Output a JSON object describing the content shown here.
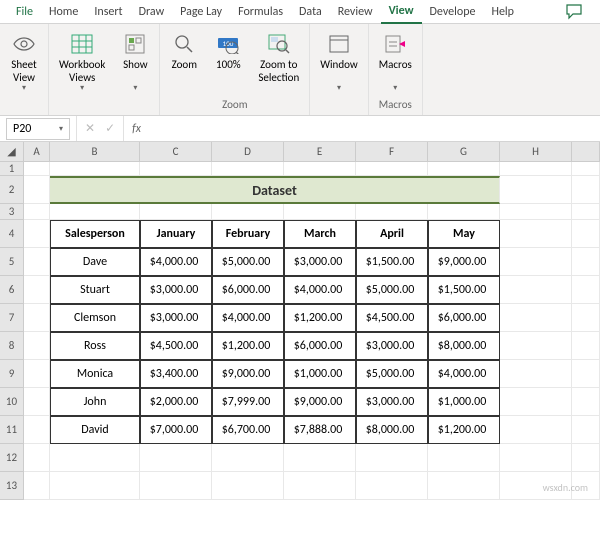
{
  "ribbon": {
    "tabs": [
      "File",
      "Home",
      "Insert",
      "Draw",
      "Page Lay",
      "Formulas",
      "Data",
      "Review",
      "View",
      "Develope",
      "Help"
    ],
    "active": "View",
    "groups": {
      "views": {
        "sheet_view": "Sheet\nView",
        "workbook_views": "Workbook\nViews",
        "show": "Show"
      },
      "zoom": {
        "zoom": "Zoom",
        "hundred": "100%",
        "zoom_to_selection": "Zoom to\nSelection",
        "label": "Zoom"
      },
      "window": {
        "window": "Window"
      },
      "macros": {
        "macros": "Macros",
        "label": "Macros"
      }
    }
  },
  "namebox": "P20",
  "sheet": {
    "columns": [
      "A",
      "B",
      "C",
      "D",
      "E",
      "F",
      "G",
      "H"
    ],
    "rows": [
      "1",
      "2",
      "3",
      "4",
      "5",
      "6",
      "7",
      "8",
      "9",
      "10",
      "11",
      "12",
      "13"
    ],
    "title": "Dataset",
    "headers": [
      "Salesperson",
      "January",
      "February",
      "March",
      "April",
      "May"
    ],
    "data": [
      {
        "sp": "Dave",
        "v": [
          "$4,000.00",
          "$5,000.00",
          "$3,000.00",
          "$1,500.00",
          "$9,000.00"
        ]
      },
      {
        "sp": "Stuart",
        "v": [
          "$3,000.00",
          "$6,000.00",
          "$4,000.00",
          "$5,000.00",
          "$1,500.00"
        ]
      },
      {
        "sp": "Clemson",
        "v": [
          "$3,000.00",
          "$4,000.00",
          "$1,200.00",
          "$4,500.00",
          "$6,000.00"
        ]
      },
      {
        "sp": "Ross",
        "v": [
          "$4,500.00",
          "$1,200.00",
          "$6,000.00",
          "$3,000.00",
          "$8,000.00"
        ]
      },
      {
        "sp": "Monica",
        "v": [
          "$3,400.00",
          "$9,000.00",
          "$1,000.00",
          "$5,000.00",
          "$4,000.00"
        ]
      },
      {
        "sp": "John",
        "v": [
          "$2,000.00",
          "$7,999.00",
          "$9,000.00",
          "$3,000.00",
          "$1,000.00"
        ]
      },
      {
        "sp": "David",
        "v": [
          "$7,000.00",
          "$6,700.00",
          "$7,888.00",
          "$8,000.00",
          "$1,200.00"
        ]
      }
    ]
  },
  "watermark": "wsxdn.com"
}
